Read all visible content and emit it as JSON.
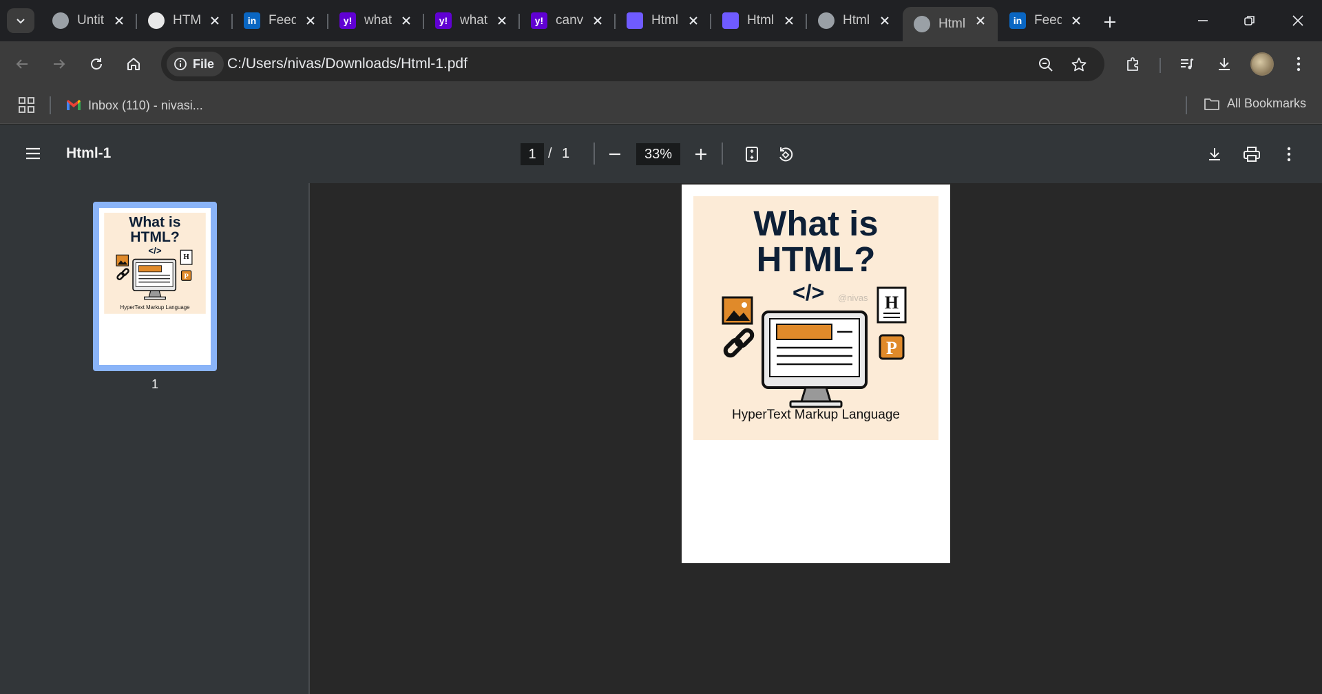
{
  "browser": {
    "tabs": [
      {
        "title": "Untitled",
        "favicon": "globe-icon",
        "active": false
      },
      {
        "title": "HTML",
        "favicon": "chatgpt-icon",
        "active": false
      },
      {
        "title": "Feed",
        "favicon": "linkedin-icon",
        "active": false
      },
      {
        "title": "what",
        "favicon": "yahoo-icon",
        "active": false
      },
      {
        "title": "what",
        "favicon": "yahoo-icon",
        "active": false
      },
      {
        "title": "canva",
        "favicon": "yahoo-icon",
        "active": false
      },
      {
        "title": "Html",
        "favicon": "image-app-icon",
        "active": false
      },
      {
        "title": "Html",
        "favicon": "image-app-icon",
        "active": false
      },
      {
        "title": "Html",
        "favicon": "globe-icon",
        "active": false
      },
      {
        "title": "Html",
        "favicon": "globe-icon",
        "active": true
      },
      {
        "title": "Feed",
        "favicon": "linkedin-icon",
        "active": false
      }
    ],
    "favicon_letters": {
      "linkedin": "in",
      "yahoo": "y!"
    },
    "address": {
      "chip_label": "File",
      "url": "C:/Users/nivas/Downloads/Html-1.pdf"
    },
    "bookmarks": {
      "items": [
        {
          "label": "Inbox (110) - nivasi...",
          "icon": "gmail-icon"
        }
      ],
      "all_bookmarks_label": "All Bookmarks"
    }
  },
  "pdf": {
    "title": "Html-1",
    "current_page": "1",
    "page_separator": "/",
    "total_pages": "1",
    "zoom": "33%",
    "thumbnails": [
      {
        "label": "1"
      }
    ],
    "poster": {
      "title_line1": "What is",
      "title_line2": "HTML?",
      "code_tag": "</>",
      "watermark": "@nivas",
      "heading_icon_letter": "H",
      "paragraph_icon_letter": "P",
      "subtitle": "HyperText Markup Language"
    }
  },
  "colors": {
    "accent_thumbnail": "#8ab4f8",
    "poster_background": "#fcebd7",
    "poster_orange": "#e08a2a",
    "poster_navy": "#0d1f36"
  }
}
